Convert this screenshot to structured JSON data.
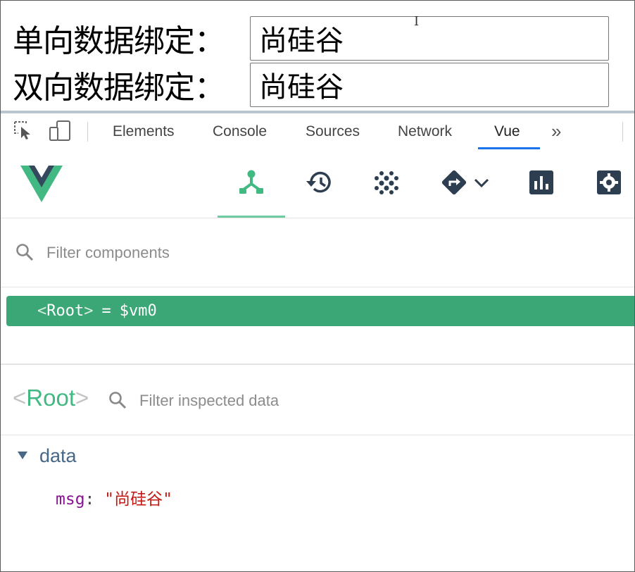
{
  "page": {
    "row1": {
      "label": "单向数据绑定：",
      "value": "尚硅谷"
    },
    "row2": {
      "label": "双向数据绑定：",
      "value": "尚硅谷"
    },
    "cursor_glyph": "I"
  },
  "devtools": {
    "tabs": [
      {
        "label": "Elements"
      },
      {
        "label": "Console"
      },
      {
        "label": "Sources"
      },
      {
        "label": "Network"
      },
      {
        "label": "Vue",
        "active": true
      }
    ],
    "overflow_glyph": "»",
    "icons": [
      "inspect-element-icon",
      "device-toolbar-icon"
    ]
  },
  "vue": {
    "accent": "#42b983",
    "toolbar_icons": [
      "components-icon",
      "history-icon",
      "vuex-icon",
      "router-icon",
      "performance-icon",
      "settings-icon"
    ],
    "filter_components_placeholder": "Filter components",
    "tree": {
      "lt": "<",
      "name": "Root",
      "gt": ">",
      "eq": "=",
      "var": "$vm0"
    },
    "inspector": {
      "lt": "<",
      "name": "Root",
      "gt": ">",
      "filter_placeholder": "Filter inspected data",
      "section": "data",
      "prop_key": "msg",
      "prop_colon": ":",
      "prop_value": "\"尚硅谷\""
    }
  }
}
